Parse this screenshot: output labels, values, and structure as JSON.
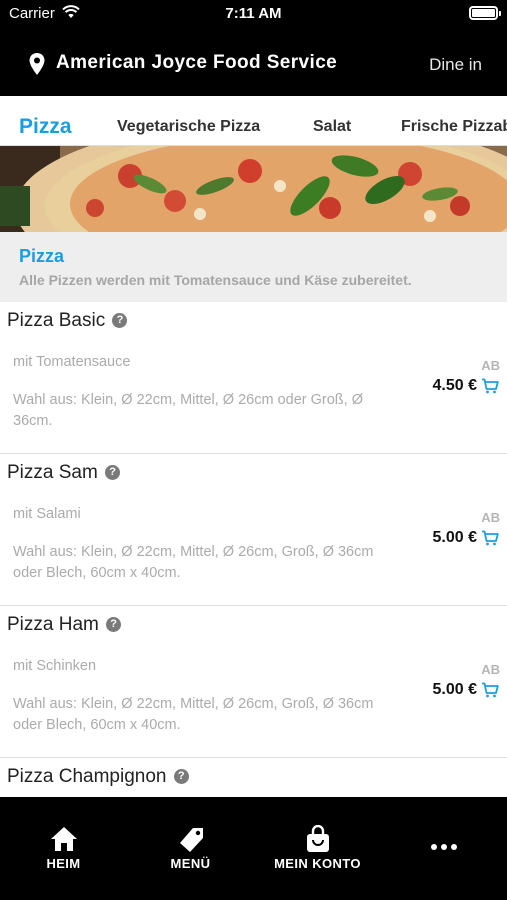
{
  "status_bar": {
    "carrier": "Carrier",
    "time": "7:11 AM"
  },
  "header": {
    "restaurant_name": "American Joyce Food Service",
    "dine_mode": "Dine in"
  },
  "tabs": [
    {
      "label": "Pizza",
      "active": true
    },
    {
      "label": "Vegetarische Pizza",
      "active": false
    },
    {
      "label": "Salat",
      "active": false
    },
    {
      "label": "Frische Pizzabr",
      "active": false
    }
  ],
  "category": {
    "title": "Pizza",
    "description": "Alle Pizzen werden mit Tomatensauce und Käse zubereitet."
  },
  "items": [
    {
      "name": "Pizza Basic",
      "description": "mit Tomatensauce",
      "options": "Wahl aus: Klein, Ø 22cm, Mittel, Ø 26cm oder Groß, Ø 36cm.",
      "price_prefix": "AB",
      "price": "4.50 €"
    },
    {
      "name": "Pizza Sam",
      "description": "mit Salami",
      "options": "Wahl aus: Klein, Ø 22cm, Mittel, Ø 26cm, Groß, Ø 36cm oder Blech, 60cm x 40cm.",
      "price_prefix": "AB",
      "price": "5.00 €"
    },
    {
      "name": "Pizza Ham",
      "description": "mit Schinken",
      "options": "Wahl aus: Klein, Ø 22cm, Mittel, Ø 26cm, Groß, Ø 36cm oder Blech, 60cm x 40cm.",
      "price_prefix": "AB",
      "price": "5.00 €"
    },
    {
      "name": "Pizza Champignon"
    }
  ],
  "help_glyph": "?",
  "bottom_nav": [
    {
      "label": "HEIM",
      "icon": "home-icon"
    },
    {
      "label": "MENÜ",
      "icon": "tag-icon"
    },
    {
      "label": "MEIN KONTO",
      "icon": "bag-icon"
    },
    {
      "label": "",
      "icon": "more-icon"
    }
  ],
  "colors": {
    "accent": "#1a9ee0",
    "header_background": "#000000",
    "muted_text": "#ababab"
  }
}
